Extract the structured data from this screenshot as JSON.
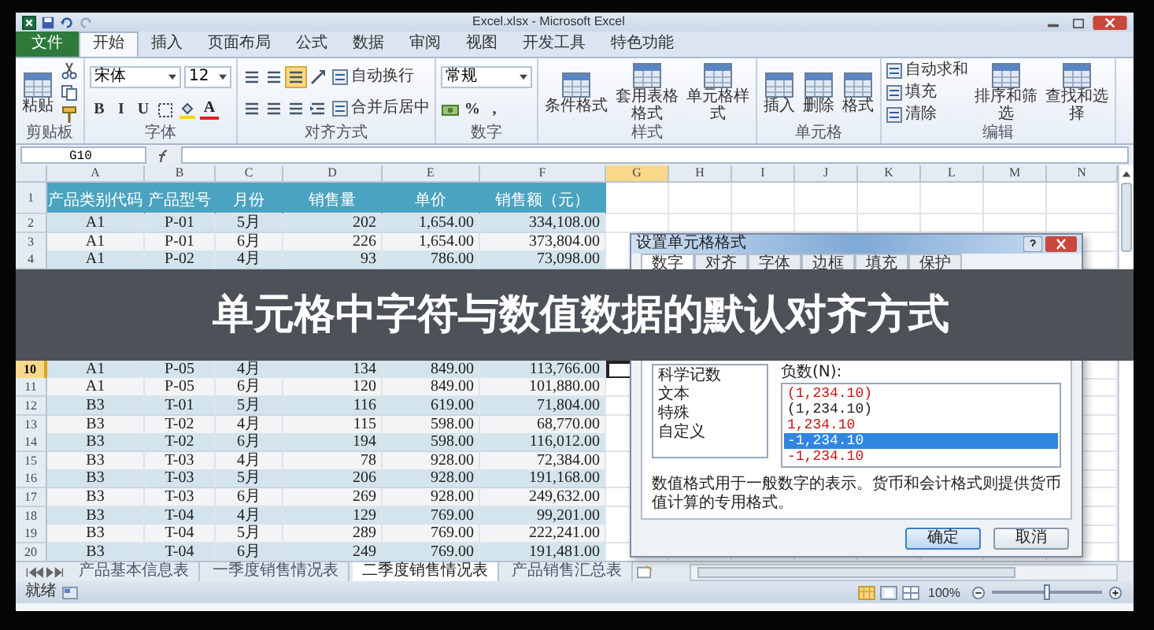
{
  "window": {
    "title": "Excel.xlsx - Microsoft Excel"
  },
  "ribbon_tabs": [
    {
      "label": "文件",
      "kind": "file",
      "selected": false
    },
    {
      "label": "开始",
      "kind": "tab",
      "selected": true
    },
    {
      "label": "插入",
      "kind": "tab",
      "selected": false
    },
    {
      "label": "页面布局",
      "kind": "tab",
      "selected": false
    },
    {
      "label": "公式",
      "kind": "tab",
      "selected": false
    },
    {
      "label": "数据",
      "kind": "tab",
      "selected": false
    },
    {
      "label": "审阅",
      "kind": "tab",
      "selected": false
    },
    {
      "label": "视图",
      "kind": "tab",
      "selected": false
    },
    {
      "label": "开发工具",
      "kind": "tab",
      "selected": false
    },
    {
      "label": "特色功能",
      "kind": "tab",
      "selected": false
    }
  ],
  "ribbon_groups": [
    {
      "label": "剪贴板",
      "columns": [
        [
          [
            {
              "kind": "large",
              "label": "粘贴"
            }
          ]
        ],
        [
          [
            {
              "kind": "cut"
            }
          ],
          [
            {
              "kind": "copy"
            }
          ],
          [
            {
              "kind": "brush"
            }
          ]
        ]
      ]
    },
    {
      "label": "字体",
      "columns": [
        [
          [
            {
              "kind": "field",
              "value": "宋体"
            },
            {
              "kind": "field",
              "value": "12"
            }
          ],
          [
            {
              "kind": "glyph",
              "label": "B"
            },
            {
              "kind": "glyph",
              "label": "I"
            },
            {
              "kind": "glyph",
              "label": "U"
            },
            {
              "kind": "border"
            },
            {
              "kind": "fill"
            },
            {
              "kind": "color-glyph",
              "label": "A"
            }
          ]
        ]
      ]
    },
    {
      "label": "对齐方式",
      "columns": [
        [
          [
            {
              "kind": "align",
              "selected": false
            },
            {
              "kind": "align",
              "selected": false
            },
            {
              "kind": "align",
              "selected": true
            },
            {
              "kind": "orient"
            }
          ],
          [
            {
              "kind": "align",
              "selected": false
            },
            {
              "kind": "align",
              "selected": false
            },
            {
              "kind": "align",
              "selected": false
            },
            {
              "kind": "indent"
            }
          ]
        ],
        [
          [
            {
              "kind": "small",
              "label": "自动换行"
            }
          ],
          [
            {
              "kind": "small",
              "label": "合并后居中"
            }
          ]
        ]
      ]
    },
    {
      "label": "数字",
      "columns": [
        [
          [
            {
              "kind": "field",
              "value": "常规"
            }
          ],
          [
            {
              "kind": "currency"
            },
            {
              "kind": "glyph",
              "label": "%"
            },
            {
              "kind": "glyph",
              "label": ","
            }
          ]
        ]
      ]
    },
    {
      "label": "样式",
      "columns": [
        [
          [
            {
              "kind": "large",
              "label": "条件格式"
            }
          ]
        ],
        [
          [
            {
              "kind": "large",
              "label": "套用表格格式"
            }
          ]
        ],
        [
          [
            {
              "kind": "large",
              "label": "单元格样式"
            }
          ]
        ]
      ]
    },
    {
      "label": "单元格",
      "columns": [
        [
          [
            {
              "kind": "large",
              "label": "插入"
            }
          ]
        ],
        [
          [
            {
              "kind": "large",
              "label": "删除"
            }
          ]
        ],
        [
          [
            {
              "kind": "large",
              "label": "格式"
            }
          ]
        ]
      ]
    },
    {
      "label": "编辑",
      "columns": [
        [
          [
            {
              "kind": "small",
              "label": "自动求和"
            }
          ],
          [
            {
              "kind": "small",
              "label": "填充"
            }
          ],
          [
            {
              "kind": "small",
              "label": "清除"
            }
          ]
        ],
        [
          [
            {
              "kind": "large",
              "label": "排序和筛选"
            }
          ]
        ],
        [
          [
            {
              "kind": "large",
              "label": "查找和选择"
            }
          ]
        ]
      ]
    }
  ],
  "formula_bar": {
    "name_box": "G10"
  },
  "sheet": {
    "columns": [
      {
        "label": "A",
        "selected": false
      },
      {
        "label": "B",
        "selected": false
      },
      {
        "label": "C",
        "selected": false
      },
      {
        "label": "D",
        "selected": false
      },
      {
        "label": "E",
        "selected": false
      },
      {
        "label": "F",
        "selected": false
      },
      {
        "label": "G",
        "selected": true
      },
      {
        "label": "H",
        "selected": false
      },
      {
        "label": "I",
        "selected": false
      },
      {
        "label": "J",
        "selected": false
      },
      {
        "label": "K",
        "selected": false
      },
      {
        "label": "L",
        "selected": false
      },
      {
        "label": "M",
        "selected": false
      },
      {
        "label": "N",
        "selected": false
      }
    ],
    "rows": [
      {
        "num": "1",
        "kind": "header",
        "selected": false,
        "cells": [
          "产品类别代码",
          "产品型号",
          "月份",
          "销售量",
          "单价",
          "销售额（元）"
        ]
      },
      {
        "num": "2",
        "kind": "data",
        "selected": false,
        "cells": [
          "A1",
          "P-01",
          "5月",
          "202",
          "1,654.00",
          "334,108.00"
        ]
      },
      {
        "num": "3",
        "kind": "data",
        "selected": false,
        "cells": [
          "A1",
          "P-01",
          "6月",
          "226",
          "1,654.00",
          "373,804.00"
        ]
      },
      {
        "num": "4",
        "kind": "data",
        "selected": false,
        "cells": [
          "A1",
          "P-02",
          "4月",
          "93",
          "786.00",
          "73,098.00"
        ]
      }
    ],
    "rows_after_banner": [
      {
        "num": "10",
        "kind": "data",
        "selected": true,
        "cells": [
          "A1",
          "P-05",
          "4月",
          "134",
          "849.00",
          "113,766.00"
        ]
      },
      {
        "num": "11",
        "kind": "data",
        "selected": false,
        "cells": [
          "A1",
          "P-05",
          "6月",
          "120",
          "849.00",
          "101,880.00"
        ]
      },
      {
        "num": "12",
        "kind": "data",
        "selected": false,
        "cells": [
          "B3",
          "T-01",
          "5月",
          "116",
          "619.00",
          "71,804.00"
        ]
      },
      {
        "num": "13",
        "kind": "data",
        "selected": false,
        "cells": [
          "B3",
          "T-02",
          "4月",
          "115",
          "598.00",
          "68,770.00"
        ]
      },
      {
        "num": "14",
        "kind": "data",
        "selected": false,
        "cells": [
          "B3",
          "T-02",
          "6月",
          "194",
          "598.00",
          "116,012.00"
        ]
      },
      {
        "num": "15",
        "kind": "data",
        "selected": false,
        "cells": [
          "B3",
          "T-03",
          "4月",
          "78",
          "928.00",
          "72,384.00"
        ]
      },
      {
        "num": "16",
        "kind": "data",
        "selected": false,
        "cells": [
          "B3",
          "T-03",
          "5月",
          "206",
          "928.00",
          "191,168.00"
        ]
      },
      {
        "num": "17",
        "kind": "data",
        "selected": false,
        "cells": [
          "B3",
          "T-03",
          "6月",
          "269",
          "928.00",
          "249,632.00"
        ]
      },
      {
        "num": "18",
        "kind": "data",
        "selected": false,
        "cells": [
          "B3",
          "T-04",
          "4月",
          "129",
          "769.00",
          "99,201.00"
        ]
      },
      {
        "num": "19",
        "kind": "data",
        "selected": false,
        "cells": [
          "B3",
          "T-04",
          "5月",
          "289",
          "769.00",
          "222,241.00"
        ]
      },
      {
        "num": "20",
        "kind": "data",
        "selected": false,
        "cells": [
          "B3",
          "T-04",
          "6月",
          "249",
          "769.00",
          "191,481.00"
        ]
      }
    ]
  },
  "sheet_tabs": [
    {
      "label": "产品基本信息表",
      "selected": false
    },
    {
      "label": "一季度销售情况表",
      "selected": false
    },
    {
      "label": "二季度销售情况表",
      "selected": true
    },
    {
      "label": "产品销售汇总表",
      "selected": false
    }
  ],
  "status_bar": {
    "status": "就绪",
    "zoom": "100%",
    "zoom_slider": {
      "level": 0.5
    }
  },
  "banner": {
    "text": "单元格中字符与数值数据的默认对齐方式"
  },
  "dialog": {
    "title": "设置单元格格式",
    "tabs": [
      {
        "label": "数字",
        "selected": true
      },
      {
        "label": "对齐",
        "selected": false
      },
      {
        "label": "字体",
        "selected": false
      },
      {
        "label": "边框",
        "selected": false
      },
      {
        "label": "填充",
        "selected": false
      },
      {
        "label": "保护",
        "selected": false
      }
    ],
    "categories": [
      "科学记数",
      "文本",
      "特殊",
      "自定义"
    ],
    "negative_label": "负数(N):",
    "negative_formats": [
      {
        "text": "(1,234.10)",
        "color": "#d01010",
        "selected": false
      },
      {
        "text": "(1,234.10)",
        "selected": false
      },
      {
        "text": "1,234.10",
        "color": "#d01010",
        "selected": false
      },
      {
        "text": "-1,234.10",
        "selected": true
      },
      {
        "text": "-1,234.10",
        "color": "#d01010",
        "selected": false
      }
    ],
    "description": "数值格式用于一般数字的表示。货币和会计格式则提供货币值计算的专用格式。",
    "buttons": [
      {
        "label": "确定",
        "kind": "default"
      },
      {
        "label": "取消",
        "kind": "normal"
      }
    ]
  }
}
